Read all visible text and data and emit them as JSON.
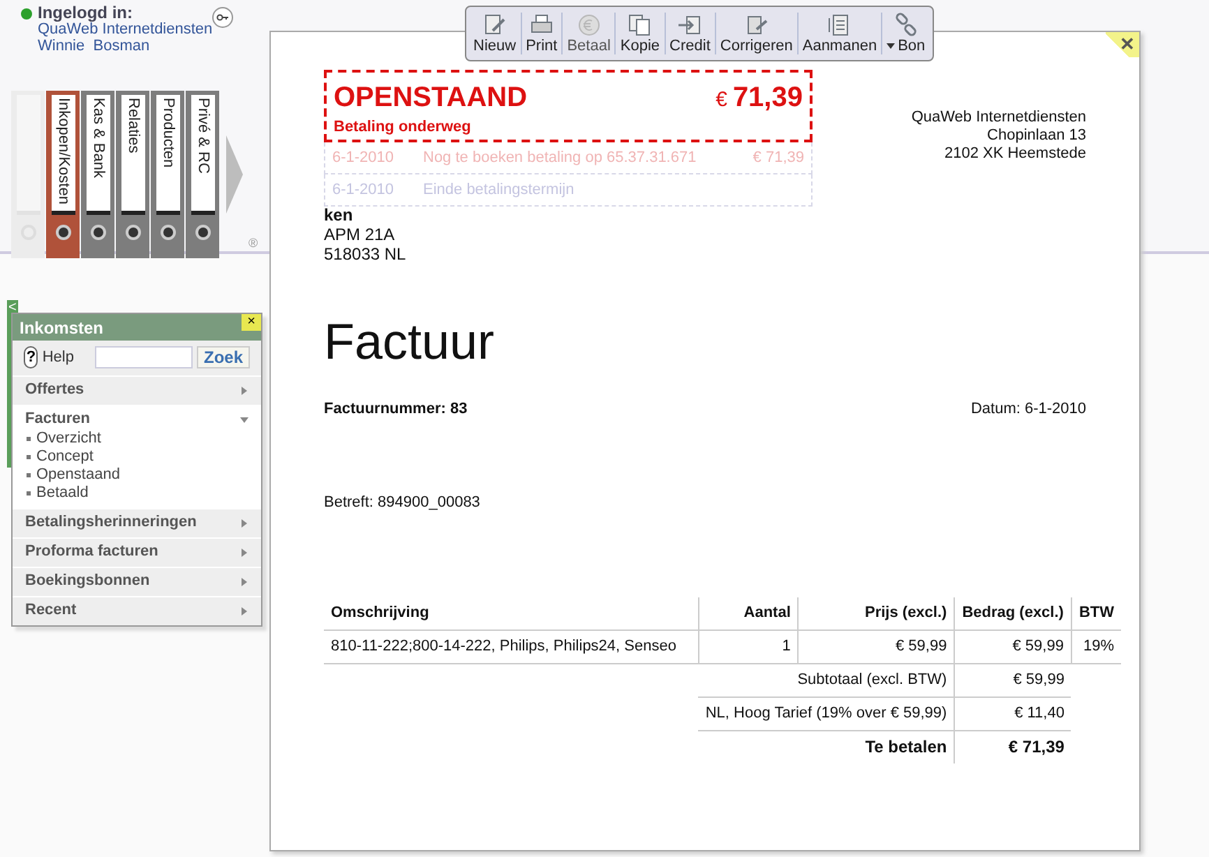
{
  "login": {
    "label": "Ingelogd in:",
    "company": "QuaWeb Internetdiensten",
    "user": "Winnie  Bosman",
    "online": true
  },
  "binders": [
    {
      "selected": false,
      "disabled": true
    },
    {
      "label": "Inkopen/Kosten",
      "selected": true,
      "disabled": false
    },
    {
      "label": "Kas & Bank",
      "selected": false,
      "disabled": false
    },
    {
      "label": "Relaties",
      "selected": false,
      "disabled": false
    },
    {
      "label": "Producten",
      "selected": false,
      "disabled": false
    },
    {
      "label": "Privé & RC",
      "selected": false,
      "disabled": false
    }
  ],
  "registered_mark": "®",
  "collapse_tab": "<",
  "toolbar": [
    {
      "label": "Nieuw",
      "disabled": false,
      "dropdown": false
    },
    {
      "label": "Print",
      "disabled": false,
      "dropdown": false
    },
    {
      "label": "Betaal",
      "disabled": true,
      "dropdown": false
    },
    {
      "label": "Kopie",
      "disabled": false,
      "dropdown": false
    },
    {
      "label": "Credit",
      "disabled": false,
      "dropdown": false
    },
    {
      "label": "Corrigeren",
      "disabled": false,
      "dropdown": false
    },
    {
      "label": "Aanmanen",
      "disabled": false,
      "dropdown": false
    },
    {
      "label": "Bon",
      "disabled": false,
      "dropdown": true
    }
  ],
  "close_symbol": "✕",
  "status": {
    "title": "OPENSTAAND",
    "currency": "€",
    "amount": "71,39",
    "subtitle": "Betaling onderweg"
  },
  "events": [
    {
      "date": "6-1-2010",
      "text": "Nog te boeken betaling op 65.37.31.671",
      "amount": "€ 71,39",
      "color": "#f0b4b4"
    },
    {
      "date": "6-1-2010",
      "text": "Einde betalingstermijn",
      "color": "#c4c4e0"
    }
  ],
  "sender": [
    "QuaWeb Internetdiensten",
    "Chopinlaan 13",
    "2102 XK Heemstede"
  ],
  "recipient": {
    "name": "ken",
    "lines": [
      "APM 21A",
      "518033 NL"
    ]
  },
  "heading": "Factuur",
  "invoice_number": "Factuurnummer: 83",
  "date": "Datum: 6-1-2010",
  "subject": "Betreft: 894900_00083",
  "table": {
    "columns": [
      "Omschrijving",
      "Aantal",
      "Prijs (excl.)",
      "Bedrag (excl.)",
      "BTW"
    ],
    "rows": [
      [
        "810-11-222;800-14-222, Philips, Philips24, Senseo",
        "1",
        "€ 59,99",
        "€ 59,99",
        "19%"
      ]
    ],
    "totals": [
      {
        "label": "Subtotaal (excl. BTW)",
        "value": "€ 59,99",
        "bold": false
      },
      {
        "label": "NL, Hoog Tarief (19% over € 59,99)",
        "value": "€ 11,40",
        "bold": false
      },
      {
        "label": "Te betalen",
        "value": "€ 71,39",
        "bold": true
      }
    ]
  },
  "panel": {
    "title": "Inkomsten",
    "close": "×",
    "help": "Help",
    "help_symbol": "?",
    "search_button": "Zoek",
    "sections": [
      {
        "label": "Offertes",
        "expanded": false
      },
      {
        "label": "Facturen",
        "expanded": true,
        "children": [
          "Overzicht",
          "Concept",
          "Openstaand",
          "Betaald"
        ]
      },
      {
        "label": "Betalingsherinneringen",
        "expanded": false
      },
      {
        "label": "Proforma facturen",
        "expanded": false
      },
      {
        "label": "Boekingsbonnen",
        "expanded": false
      },
      {
        "label": "Recent",
        "expanded": false
      }
    ]
  }
}
